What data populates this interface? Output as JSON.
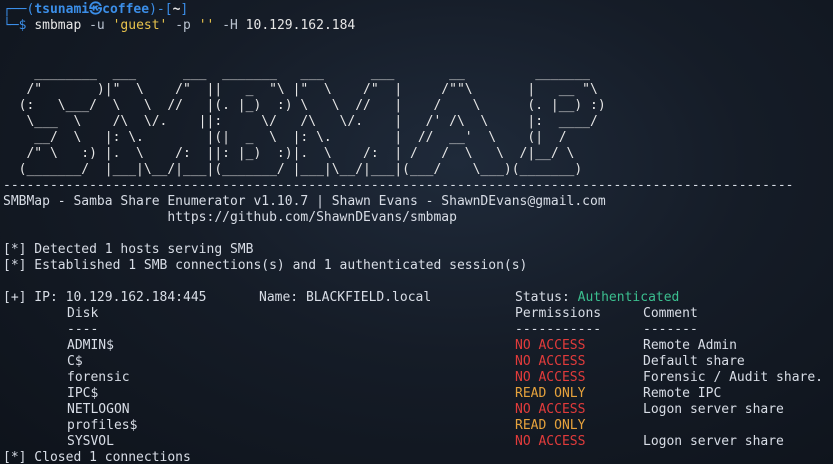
{
  "prompt": {
    "corner_top": "┌──",
    "corner_bottom": "└─",
    "open_paren": "(",
    "user": "tsunami",
    "at_symbol": "㉿",
    "host": "coffee",
    "close_paren": ")-[",
    "cwd": "~",
    "close_bracket": "]",
    "dollar": "$",
    "command": "smbmap",
    "flag_u": "-u",
    "user_arg": "'guest'",
    "flag_p": "-p",
    "pass_arg": "''",
    "flag_h": "-H",
    "host_arg": "10.129.162.184"
  },
  "banner": [
    "    ________  ___      ___  _______   ___      ___       __         _______",
    "   /\"       )|\"  \\    /\"  ||   _  \"\\ |\"  \\    /\"  |     /\"\"\\       |   __ \"\\",
    "  (:   \\___/  \\   \\  //   |(. |_)  :) \\   \\  //   |    /    \\      (. |__) :)",
    "   \\___  \\    /\\  \\/.    ||:     \\/   /\\   \\/.    |   /' /\\  \\     |:  ____/",
    "    __/  \\   |: \\.        |(|  _  \\  |: \\.        |  //  __'  \\    (|  /",
    "   /\" \\   :) |.  \\    /:  ||: |_)  :)|.  \\    /:  | /   /  \\   \\  /|__/ \\",
    "  (_______/  |___|\\__/|___|(_______/ |___|\\__/|___|(___/    \\___)(_______)"
  ],
  "separator": "-----------------------------------------------------------------------------------------------------",
  "tool_info": "SMBMap - Samba Share Enumerator v1.10.7 | Shawn Evans - ShawnDEvans@gmail.com",
  "tool_url": "                     https://github.com/ShawnDEvans/smbmap",
  "messages": {
    "detected": "[*] Detected 1 hosts serving SMB",
    "established": "[*] Established 1 SMB connections(s) and 1 authenticated session(s)",
    "closed": "[*] Closed 1 connections"
  },
  "host": {
    "prefix": "[+] IP: 10.129.162.184:445",
    "name": "Name: BLACKFIELD.local",
    "status_label": "Status: ",
    "status_value": "Authenticated"
  },
  "table": {
    "headers": {
      "disk": "Disk",
      "permissions": "Permissions",
      "comment": "Comment"
    },
    "underline": {
      "disk": "----",
      "permissions": "-----------",
      "comment": "-------"
    },
    "rows": [
      {
        "disk": "ADMIN$",
        "permissions": "NO ACCESS",
        "comment": "Remote Admin",
        "level": "none"
      },
      {
        "disk": "C$",
        "permissions": "NO ACCESS",
        "comment": "Default share",
        "level": "none"
      },
      {
        "disk": "forensic",
        "permissions": "NO ACCESS",
        "comment": "Forensic / Audit share.",
        "level": "none"
      },
      {
        "disk": "IPC$",
        "permissions": "READ ONLY",
        "comment": "Remote IPC",
        "level": "read"
      },
      {
        "disk": "NETLOGON",
        "permissions": "NO ACCESS",
        "comment": "Logon server share",
        "level": "none"
      },
      {
        "disk": "profiles$",
        "permissions": "READ ONLY",
        "comment": "",
        "level": "read"
      },
      {
        "disk": "SYSVOL",
        "permissions": "NO ACCESS",
        "comment": "Logon server share",
        "level": "none"
      }
    ]
  },
  "colors": {
    "prompt_blue": "#3b8ee8",
    "authenticated_green": "#3bbf8f",
    "no_access_red": "#e23b3b",
    "read_only_orange": "#e6a23c"
  }
}
